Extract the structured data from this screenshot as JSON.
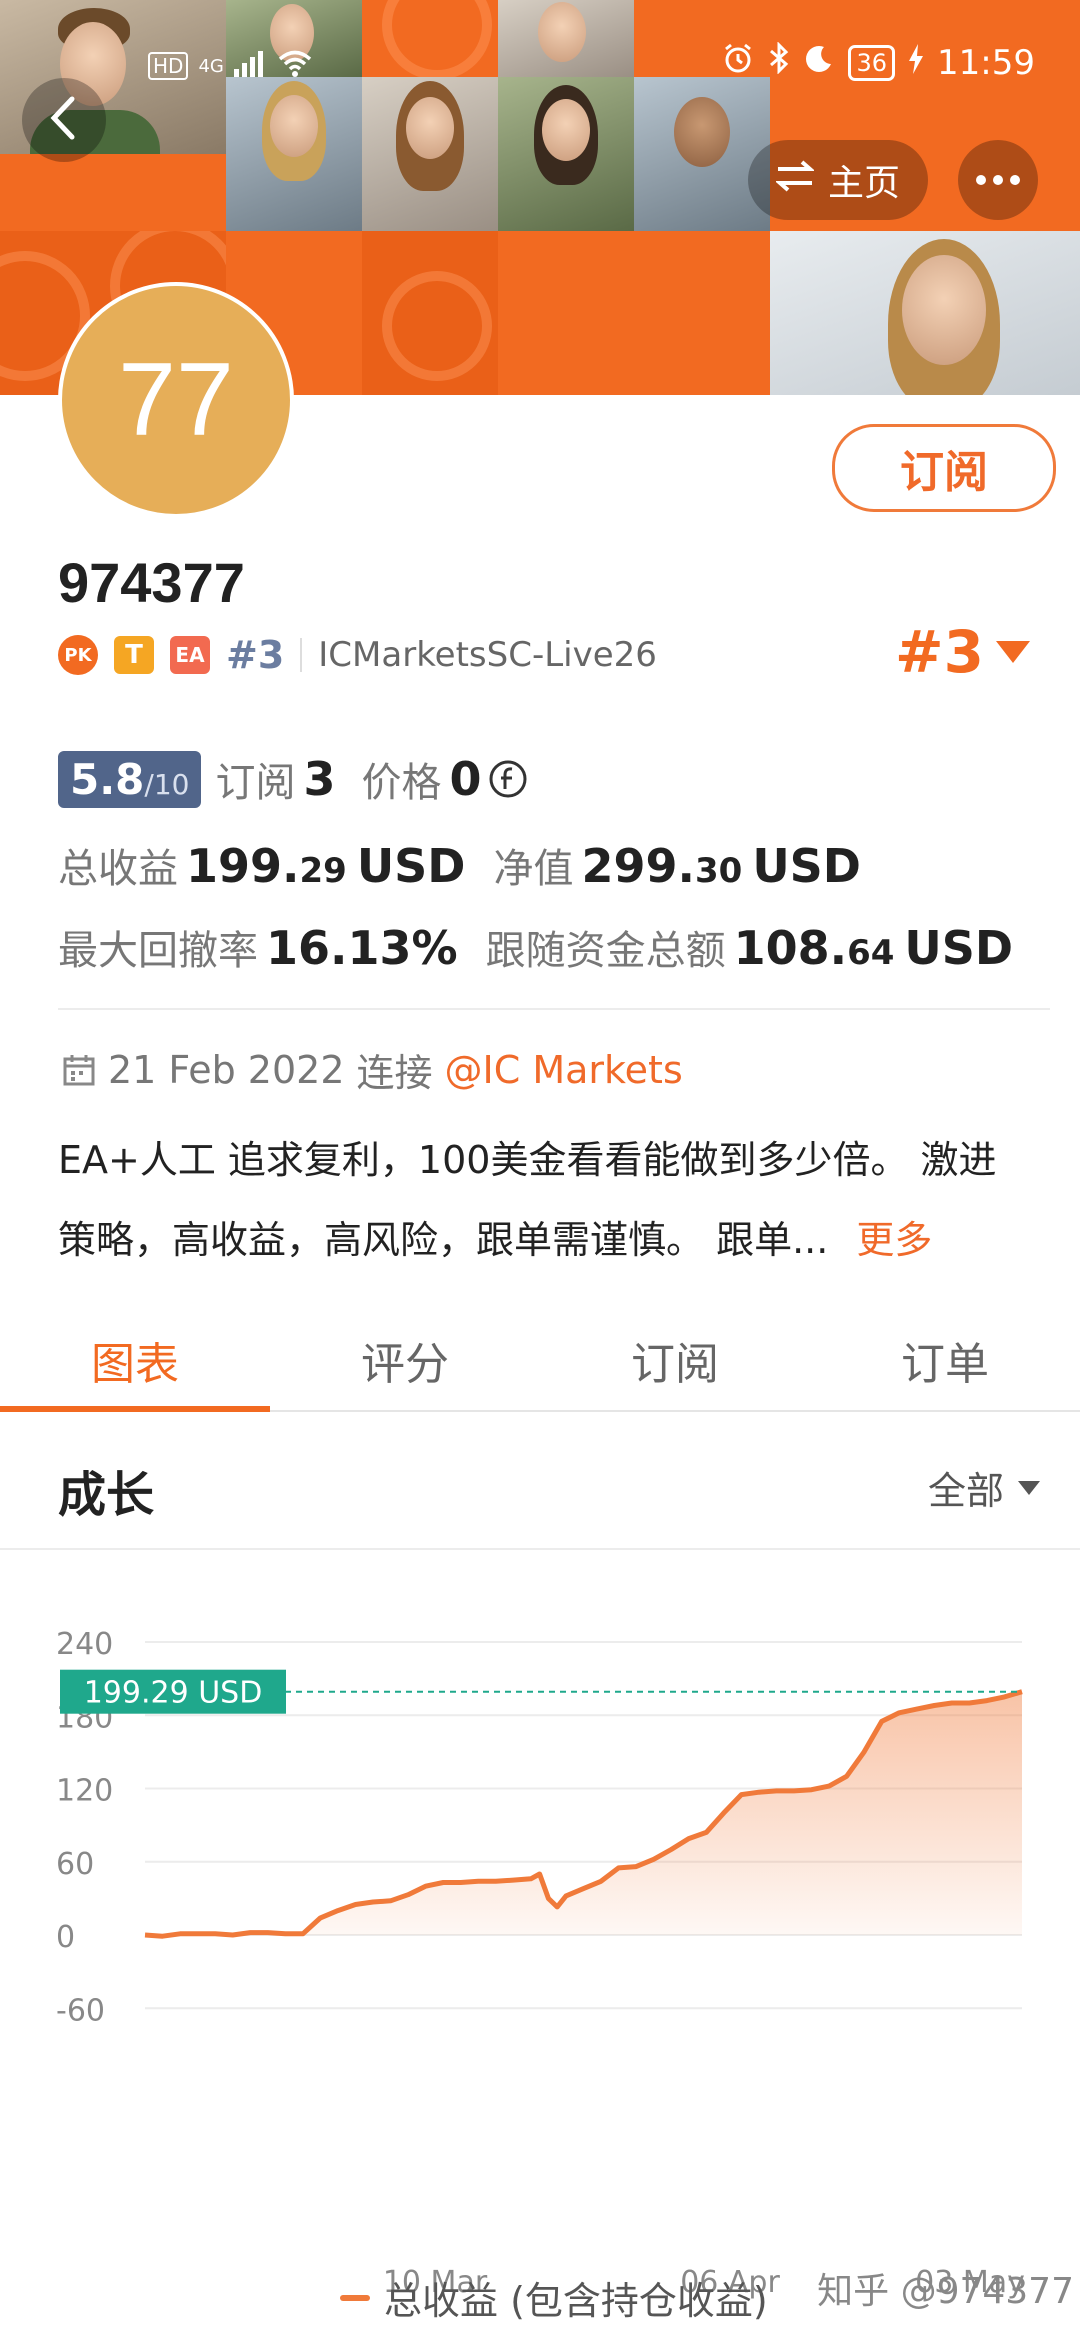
{
  "status_bar": {
    "time": "11:59",
    "battery": "36",
    "network": "4G",
    "hd": "HD"
  },
  "header": {
    "home_label": "主页",
    "back_icon": "chevron-left-icon",
    "switch_icon": "swap-arrows-icon",
    "more_icon": "more-horizontal-icon"
  },
  "profile": {
    "avatar_text": "77",
    "avatar_color": "#e6ae58",
    "subscribe_label": "订阅",
    "name": "974377",
    "badges": {
      "pk": "PK",
      "t": "T",
      "ea": "EA"
    },
    "rank_small": "#3",
    "server": "ICMarketsSC-Live26",
    "rank_big": "#3"
  },
  "stats": {
    "score": "5.8",
    "score_max": "/10",
    "subs_label": "订阅",
    "subs_value": "3",
    "price_label": "价格",
    "price_value": "0",
    "total_profit_label": "总收益",
    "total_profit_int": "199.",
    "total_profit_dec": "29",
    "total_profit_unit": "USD",
    "equity_label": "净值",
    "equity_int": "299.",
    "equity_dec": "30",
    "equity_unit": "USD",
    "drawdown_label": "最大回撤率",
    "drawdown_value": "16.13%",
    "follow_label": "跟随资金总额",
    "follow_int": "108.",
    "follow_dec": "64",
    "follow_unit": "USD"
  },
  "info": {
    "date": "21 Feb 2022",
    "connect_label": "连接",
    "broker": "@IC Markets",
    "desc_line1": "EA+人工 追求复利，100美金看看能做到多少倍。 激进",
    "desc_line2": "策略，高收益，高风险，跟单需谨慎。 跟单...",
    "more": "更多"
  },
  "tabs": [
    "图表",
    "评分",
    "订阅",
    "订单"
  ],
  "section": {
    "title": "成长",
    "filter": "全部"
  },
  "colors": {
    "accent": "#f26a21",
    "score_bg": "#51658a",
    "line": "#f07a3a",
    "current_label_bg": "#1fa88c"
  },
  "chart_data": {
    "type": "area",
    "ylim": [
      -60,
      240
    ],
    "yticks": [
      "240",
      "180",
      "120",
      "60",
      "0",
      "-60"
    ],
    "xticks": [
      "10 Mar",
      "06 Apr",
      "03 May"
    ],
    "current_label": "199.29 USD",
    "current_value": 199.29,
    "legend": "总收益 (包含持仓收益)",
    "series": [
      {
        "name": "总收益 (包含持仓收益)",
        "x": [
          0,
          2,
          4,
          6,
          8,
          10,
          12,
          14,
          16,
          18,
          20,
          22,
          24,
          26,
          28,
          30,
          32,
          34,
          36,
          38,
          40,
          42,
          44,
          45,
          46,
          47,
          48,
          50,
          52,
          54,
          56,
          58,
          60,
          62,
          64,
          66,
          68,
          70,
          72,
          74,
          76,
          78,
          80,
          82,
          84,
          86,
          88,
          90,
          92,
          94,
          96,
          98,
          100
        ],
        "values": [
          0,
          -1,
          1,
          1,
          1,
          0,
          2,
          2,
          1,
          1,
          14,
          20,
          25,
          27,
          28,
          33,
          40,
          43,
          43,
          44,
          44,
          45,
          46,
          50,
          30,
          23,
          32,
          38,
          44,
          55,
          56,
          62,
          70,
          79,
          84,
          100,
          115,
          117,
          118,
          118,
          119,
          122,
          130,
          150,
          175,
          182,
          185,
          188,
          190,
          190,
          192,
          195,
          199.29
        ]
      }
    ]
  },
  "watermark": "知乎 @974377"
}
